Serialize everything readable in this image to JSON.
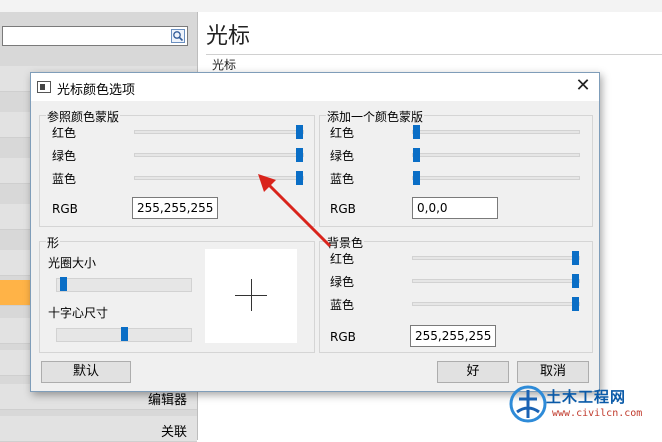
{
  "background": {
    "title": "光标",
    "subtitle": "光标",
    "sidebar_labels": {
      "editor": "编辑器",
      "association": "关联"
    }
  },
  "dialog": {
    "title": "光标颜色选项",
    "close_glyph": "✕",
    "reference_mask": {
      "label": "参照颜色蒙版",
      "red_label": "红色",
      "green_label": "绿色",
      "blue_label": "蓝色",
      "rgb_label": "RGB",
      "rgb_value": "255,255,255",
      "red_level": 1.0,
      "green_level": 1.0,
      "blue_level": 1.0
    },
    "add_mask": {
      "label": "添加一个颜色蒙版",
      "red_label": "红色",
      "green_label": "绿色",
      "blue_label": "蓝色",
      "rgb_label": "RGB",
      "rgb_value": "0,0,0",
      "red_level": 0.0,
      "green_level": 0.0,
      "blue_level": 0.0
    },
    "shape": {
      "label": "形",
      "aperture_label": "光圈大小",
      "crosshair_label": "十字心尺寸",
      "aperture_level": 0.02,
      "crosshair_level": 0.5
    },
    "background_color": {
      "label": "背景色",
      "red_label": "红色",
      "green_label": "绿色",
      "blue_label": "蓝色",
      "rgb_label": "RGB",
      "rgb_value": "255,255,255",
      "red_level": 1.0,
      "green_level": 1.0,
      "blue_level": 1.0
    },
    "buttons": {
      "default": "默认",
      "ok": "好",
      "cancel": "取消"
    }
  },
  "watermark": {
    "title": "土木工程网",
    "url": "www.civilcn.com"
  },
  "colors": {
    "accent": "#0a6ec6",
    "annotation": "#d9241c",
    "sidebar_active": "#ffb347"
  }
}
